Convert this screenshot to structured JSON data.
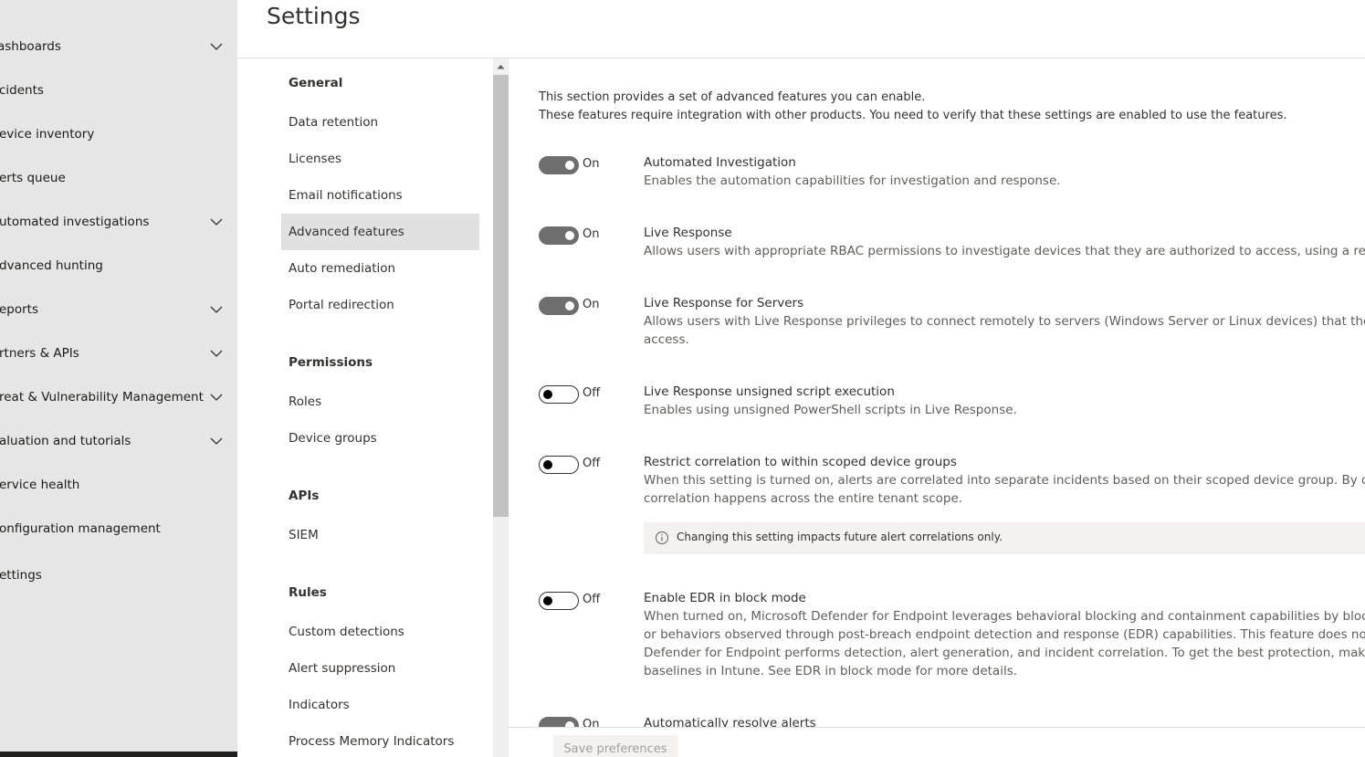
{
  "leftnav": {
    "items": [
      {
        "label": "ashboards",
        "chevron": true
      },
      {
        "label": "cidents",
        "chevron": false
      },
      {
        "label": "evice inventory",
        "chevron": false
      },
      {
        "label": "erts queue",
        "chevron": false
      },
      {
        "label": "utomated investigations",
        "chevron": true
      },
      {
        "label": "dvanced hunting",
        "chevron": false
      },
      {
        "label": "eports",
        "chevron": true
      },
      {
        "label": "rtners & APIs",
        "chevron": true
      },
      {
        "label": "reat & Vulnerability Management",
        "chevron": true
      },
      {
        "label": "aluation and tutorials",
        "chevron": true
      },
      {
        "label": "ervice health",
        "chevron": false
      },
      {
        "label": "onfiguration management",
        "chevron": false
      },
      {
        "label": "ettings",
        "chevron": false
      }
    ]
  },
  "header": {
    "title": "Settings"
  },
  "subnav": {
    "general": {
      "heading": "General",
      "items": [
        "Data retention",
        "Licenses",
        "Email notifications",
        "Advanced features",
        "Auto remediation",
        "Portal redirection"
      ]
    },
    "permissions": {
      "heading": "Permissions",
      "items": [
        "Roles",
        "Device groups"
      ]
    },
    "apis": {
      "heading": "APIs",
      "items": [
        "SIEM"
      ]
    },
    "rules": {
      "heading": "Rules",
      "items": [
        "Custom detections",
        "Alert suppression",
        "Indicators",
        "Process Memory Indicators"
      ]
    },
    "selected": "Advanced features"
  },
  "content": {
    "intro_line1": "This section provides a set of advanced features you can enable.",
    "intro_line2": "These features require integration with other products. You need to verify that these settings are enabled to use the features.",
    "features": [
      {
        "title": "Automated Investigation",
        "state": "On",
        "enabled": true,
        "desc": [
          "Enables the automation capabilities for investigation and response."
        ]
      },
      {
        "title": "Live Response",
        "state": "On",
        "enabled": true,
        "desc": [
          "Allows users with appropriate RBAC permissions to investigate devices that they are authorized to access, using a remote shell co"
        ]
      },
      {
        "title": "Live Response for Servers",
        "state": "On",
        "enabled": true,
        "desc": [
          "Allows users with Live Response privileges to connect remotely to servers (Windows Server or Linux devices) that they are author",
          "access."
        ]
      },
      {
        "title": "Live Response unsigned script execution",
        "state": "Off",
        "enabled": false,
        "desc": [
          "Enables using unsigned PowerShell scripts in Live Response."
        ]
      },
      {
        "title": "Restrict correlation to within scoped device groups",
        "state": "Off",
        "enabled": false,
        "desc": [
          "When this setting is turned on, alerts are correlated into separate incidents based on their scoped device group. By default, incid",
          "correlation happens across the entire tenant scope."
        ]
      },
      {
        "title": "Enable EDR in block mode",
        "state": "Off",
        "enabled": false,
        "desc": [
          "When turned on, Microsoft Defender for Endpoint leverages behavioral blocking and containment capabilities by blocking malici",
          "or behaviors observed through post-breach endpoint detection and response (EDR) capabilities. This feature does not change ho",
          "Defender for Endpoint performs detection, alert generation, and incident correlation. To get the best protection, make sure to ap",
          "baselines in Intune. See EDR in block mode for more details."
        ]
      },
      {
        "title": "Automatically resolve alerts",
        "state": "On",
        "enabled": true,
        "desc": []
      }
    ],
    "info_box": "Changing this setting impacts future alert correlations only."
  },
  "actions": {
    "save_label": "Save preferences"
  },
  "colors": {
    "nav_bg": "#e6e6e6",
    "toggle_on": "#6e6e6e",
    "selected_bg": "#e1e1e1"
  }
}
